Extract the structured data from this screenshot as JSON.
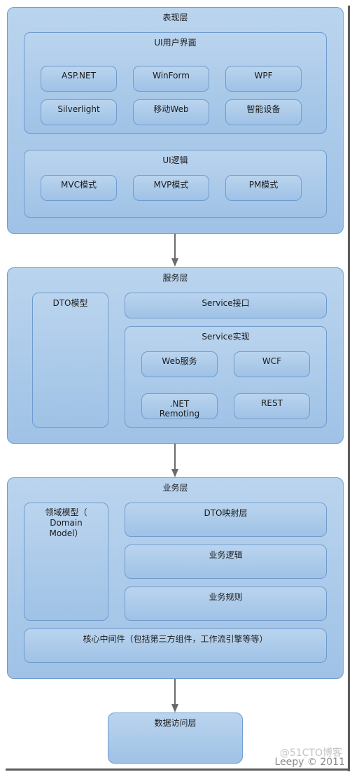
{
  "presentation_layer": {
    "title": "表现层",
    "ui_interface": {
      "title": "UI用户界面",
      "items": [
        "ASP.NET",
        "WinForm",
        "WPF",
        "Silverlight",
        "移动Web",
        "智能设备"
      ]
    },
    "ui_logic": {
      "title": "UI逻辑",
      "items": [
        "MVC模式",
        "MVP模式",
        "PM模式"
      ]
    }
  },
  "service_layer": {
    "title": "服务层",
    "dto_model": "DTO模型",
    "service_interface": "Service接口",
    "service_impl": {
      "title": "Service实现",
      "items": [
        "Web服务",
        "WCF",
        ".NET\nRemoting",
        "REST"
      ]
    }
  },
  "business_layer": {
    "title": "业务层",
    "domain_model": "领域模型（\nDomain\nModel）",
    "dto_mapping": "DTO映射层",
    "business_logic": "业务逻辑",
    "business_rules": "业务规则",
    "core_middleware": "核心中间件（包括第三方组件，工作流引擎等等）"
  },
  "data_access_layer": {
    "title": "数据访问层"
  },
  "watermark": {
    "author": "Leepy © 2011",
    "site": "@51CTO博客"
  },
  "colors": {
    "box_top": "#bad4ee",
    "box_bottom": "#9fc2e6",
    "border": "#6f9ccf",
    "arrow": "#6b6b6b"
  }
}
